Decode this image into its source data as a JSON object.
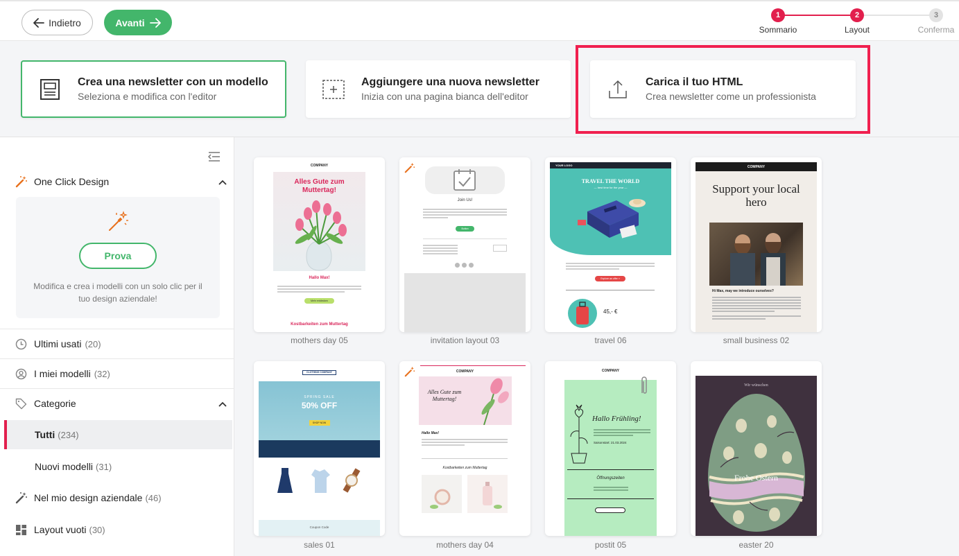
{
  "nav": {
    "back_label": "Indietro",
    "next_label": "Avanti",
    "steps": [
      {
        "number": "1",
        "label": "Sommario",
        "state": "done"
      },
      {
        "number": "2",
        "label": "Layout",
        "state": "current"
      },
      {
        "number": "3",
        "label": "Conferma",
        "state": "upcoming"
      }
    ]
  },
  "options": [
    {
      "title": "Crea una newsletter con un modello",
      "subtitle": "Seleziona e modifica con l'editor",
      "icon": "template-icon",
      "selected": true
    },
    {
      "title": "Aggiungere una nuova newsletter",
      "subtitle": "Inizia con una pagina bianca dell'editor",
      "icon": "blank-page-icon",
      "selected": false
    },
    {
      "title": "Carica il tuo HTML",
      "subtitle": "Crea newsletter come un professionista",
      "icon": "upload-icon",
      "selected": false
    }
  ],
  "sidebar": {
    "one_click": {
      "title": "One Click Design",
      "button": "Prova",
      "description": "Modifica e crea i modelli con un solo clic per il tuo design aziendale!"
    },
    "recent": {
      "label": "Ultimi usati",
      "count": "(20)"
    },
    "mine": {
      "label": "I miei modelli",
      "count": "(32)"
    },
    "categories": {
      "title": "Categorie",
      "items": [
        {
          "label": "Tutti",
          "count": "(234)",
          "active": true
        },
        {
          "label": "Nuovi modelli",
          "count": "(31)",
          "active": false
        },
        {
          "label": "Nel mio design aziendale",
          "count": "(46)",
          "active": false
        },
        {
          "label": "Layout vuoti",
          "count": "(30)",
          "active": false
        }
      ]
    }
  },
  "templates": [
    {
      "name": "mothers day 05",
      "company": "COMPANY",
      "headline": "Alles Gute zum Muttertag!",
      "greeting": "Hallo Max!",
      "button": "Mehr entdecken",
      "footer": "Kostbarkeiten zum Muttertag"
    },
    {
      "name": "invitation layout 03",
      "headline": "Join Us!",
      "button": "Button"
    },
    {
      "name": "travel 06",
      "logo": "YOUR LOGO",
      "headline": "TRAVEL THE WORLD",
      "subline": "— best time for the year —",
      "button": "Explore an offer »",
      "price": "45,- €"
    },
    {
      "name": "small business 02",
      "company": "COMPANY",
      "headline": "Support your local hero",
      "question": "Hi Max, may we introduce ourselves?"
    },
    {
      "name": "sales 01",
      "company": "CLOTHING COMPANY",
      "kicker": "SPRING SALE",
      "headline": "50% OFF",
      "button": "SHOP NOW",
      "footer": "Coupon Code"
    },
    {
      "name": "mothers day 04",
      "company": "COMPANY",
      "headline": "Alles Gute zum Muttertag!",
      "greeting": "Hallo Max!",
      "subhead": "Kostbarkeiten zum Muttertag"
    },
    {
      "name": "postit 05",
      "company": "COMPANY",
      "headline": "Hallo Frühling!",
      "date": "Saisonstart: 21.03.2024",
      "hours": "Öffnungszeiten"
    },
    {
      "name": "easter 20",
      "kicker": "Wir wünschen",
      "headline": "Frohe Ostern"
    }
  ],
  "colors": {
    "accent_green": "#43b66b",
    "step_red": "#e21f4d",
    "highlight_red": "#f0204f"
  }
}
